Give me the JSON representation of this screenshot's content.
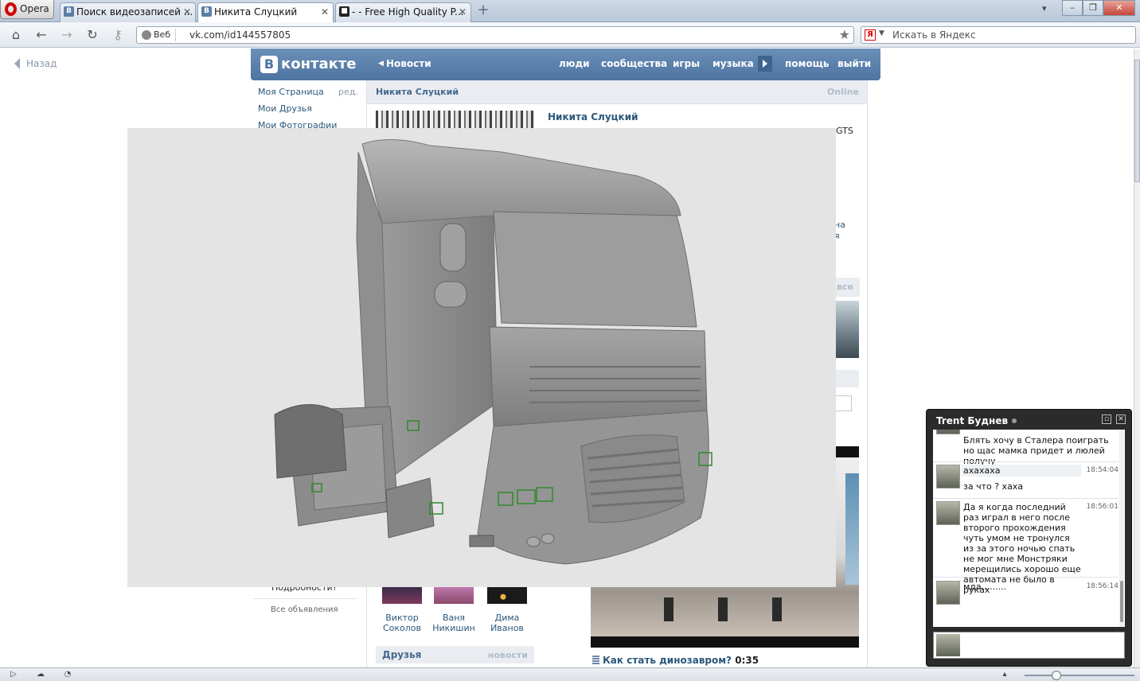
{
  "browser": {
    "menu_label": "Opera",
    "tabs": [
      {
        "favicon": "В",
        "title": "Поиск видеозаписей ..."
      },
      {
        "favicon": "В",
        "title": "Никита Слуцкий"
      },
      {
        "favicon": "■",
        "title": "- - Free High Quality P..."
      }
    ],
    "web_chip": "Веб",
    "url": "vk.com/id144557805",
    "search_placeholder": "Искать в Яндекс",
    "search_engine_letter": "Я"
  },
  "page": {
    "back_label": "Назад",
    "vk_logo_letter": "В",
    "vk_logo_text": "контакте",
    "top_nav": {
      "news": "Новости",
      "people": "люди",
      "communities": "сообщества",
      "games": "игры",
      "music": "музыка",
      "help": "помощь",
      "logout": "выйти"
    },
    "left_menu": {
      "my_page": "Моя Страница",
      "edit": "ред.",
      "my_friends": "Мои Друзья",
      "my_photos": "Мои Фотографии"
    },
    "profile": {
      "header_name": "Никита Слуцкий",
      "status": "Online",
      "name": "Никита Слуцкий",
      "partial_text_right": "GTS",
      "partial_blue_1": "на",
      "partial_blue_2": "я",
      "partial_all": "все"
    },
    "ads": {
      "more_label": "Подробности?",
      "all_label": "Все объявления"
    },
    "friends": {
      "items": [
        {
          "line1": "Виктор",
          "line2": "Соколов"
        },
        {
          "line1": "Ваня",
          "line2": "Никишин"
        },
        {
          "line1": "Дима",
          "line2": "Иванов"
        }
      ],
      "section_title": "Друзья",
      "section_link": "новости"
    },
    "video": {
      "title": "Как стать динозавром?",
      "duration": "0:35"
    },
    "overlay_marker": "v"
  },
  "viewer_colors": {
    "background": "#e4e4e4",
    "model_light": "#a9a9a9",
    "model_mid": "#8c8c8c",
    "model_dark": "#6e6e6e",
    "helpers": "#2f8a2f"
  },
  "chat": {
    "title": "Trent Буднев",
    "messages": [
      {
        "text": "Блять хочу в Сталера поиграть но щас мамка придет и люлей получу",
        "time": ""
      },
      {
        "text": "ахахаха",
        "time": "18:54:04"
      },
      {
        "text": "за что ? хаха",
        "time": ""
      },
      {
        "text": "Да я когда последний раз играл в него после второго прохождения чуть умом не тронулся из за этого ночью спать не мог мне Монстряки мерещились хорошо еще автомата не было в руках",
        "time": "18:56:01"
      },
      {
        "text": "мда.........",
        "time": "18:56:14"
      }
    ]
  }
}
